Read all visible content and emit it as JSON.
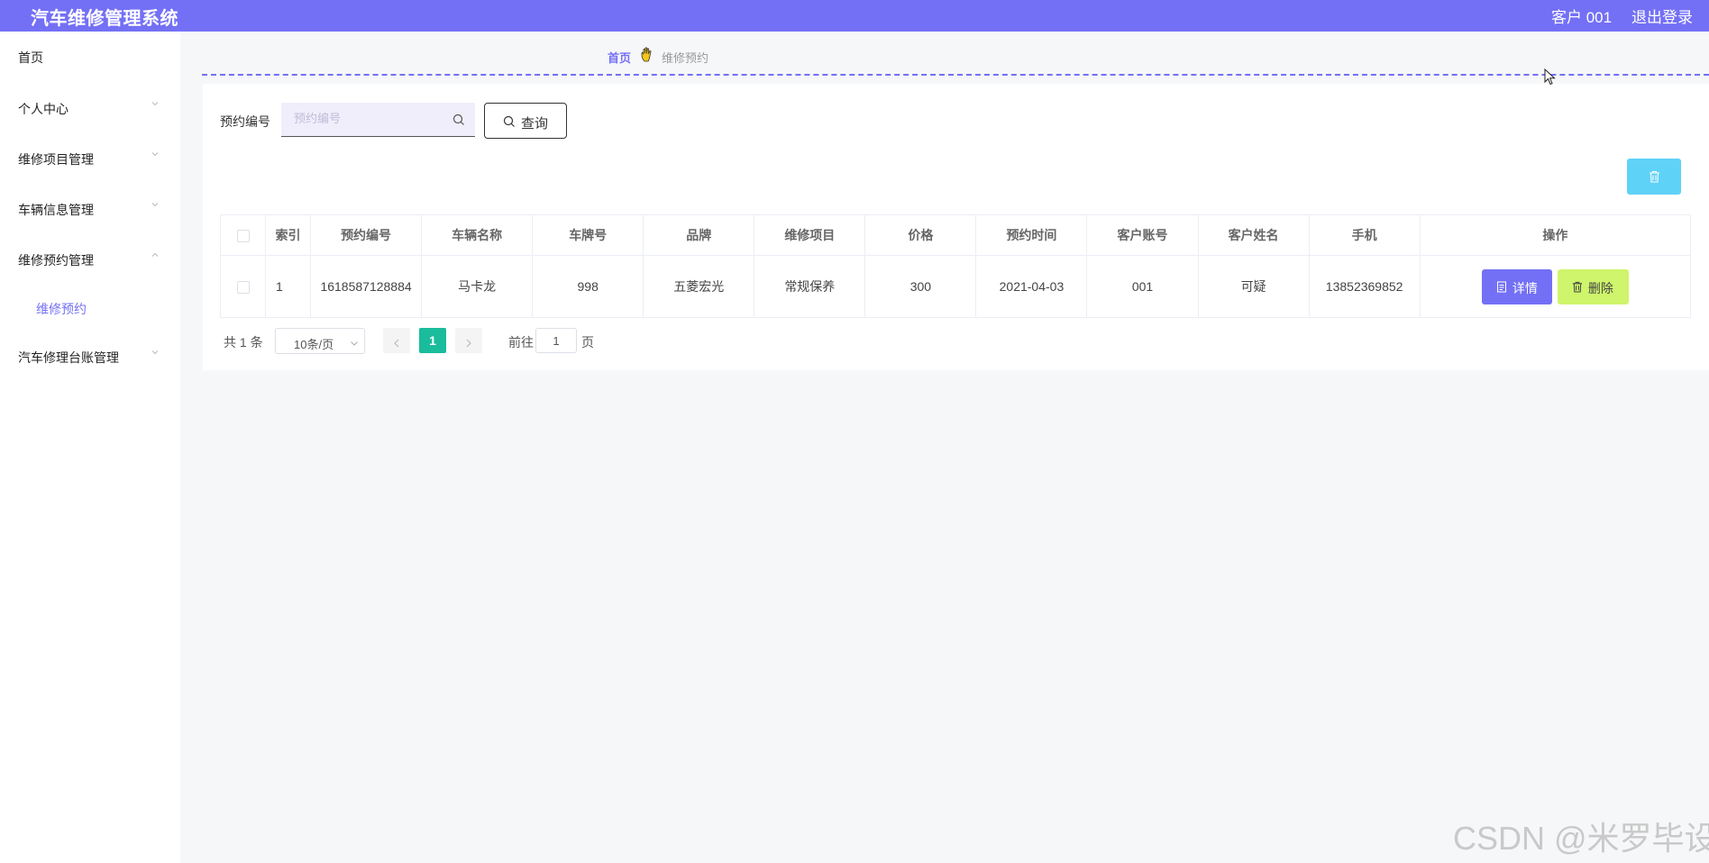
{
  "header": {
    "app_title": "汽车维修管理系统",
    "user_label": "客户 001",
    "logout_label": "退出登录"
  },
  "sidebar": {
    "items": [
      {
        "label": "首页"
      },
      {
        "label": "个人中心"
      },
      {
        "label": "维修项目管理"
      },
      {
        "label": "车辆信息管理"
      },
      {
        "label": "维修预约管理"
      },
      {
        "label": "维修预约"
      },
      {
        "label": "汽车修理台账管理"
      }
    ]
  },
  "breadcrumb": {
    "home": "首页",
    "current": "维修预约"
  },
  "search": {
    "label": "预约编号",
    "placeholder": "预约编号",
    "value": "",
    "query_label": "查询"
  },
  "table": {
    "headers": [
      "索引",
      "预约编号",
      "车辆名称",
      "车牌号",
      "品牌",
      "维修项目",
      "价格",
      "预约时间",
      "客户账号",
      "客户姓名",
      "手机",
      "操作"
    ],
    "rows": [
      {
        "index": "1",
        "booking_no": "1618587128884",
        "vehicle_name": "马卡龙",
        "plate": "998",
        "brand": "五菱宏光",
        "repair_item": "常规保养",
        "price": "300",
        "booking_time": "2021-04-03",
        "customer_account": "001",
        "customer_name": "可疑",
        "phone": "13852369852",
        "detail_label": "详情",
        "delete_label": "删除"
      }
    ]
  },
  "pagination": {
    "total": "共 1 条",
    "page_size": "10条/页",
    "current_page": "1",
    "goto_label": "前往",
    "goto_value": "1",
    "page_suffix": "页"
  },
  "watermark": "CSDN @米罗毕设",
  "colors": {
    "primary": "#7470f5",
    "batch_delete": "#5fd2f7",
    "delete_button": "#cef56b",
    "active_page": "#1abc9c"
  },
  "icons": [
    "search-icon",
    "trash-icon",
    "document-icon",
    "chevron-down-icon",
    "chevron-up-icon",
    "chevron-left-icon",
    "chevron-right-icon",
    "hand-icon",
    "mouse-cursor-icon"
  ]
}
